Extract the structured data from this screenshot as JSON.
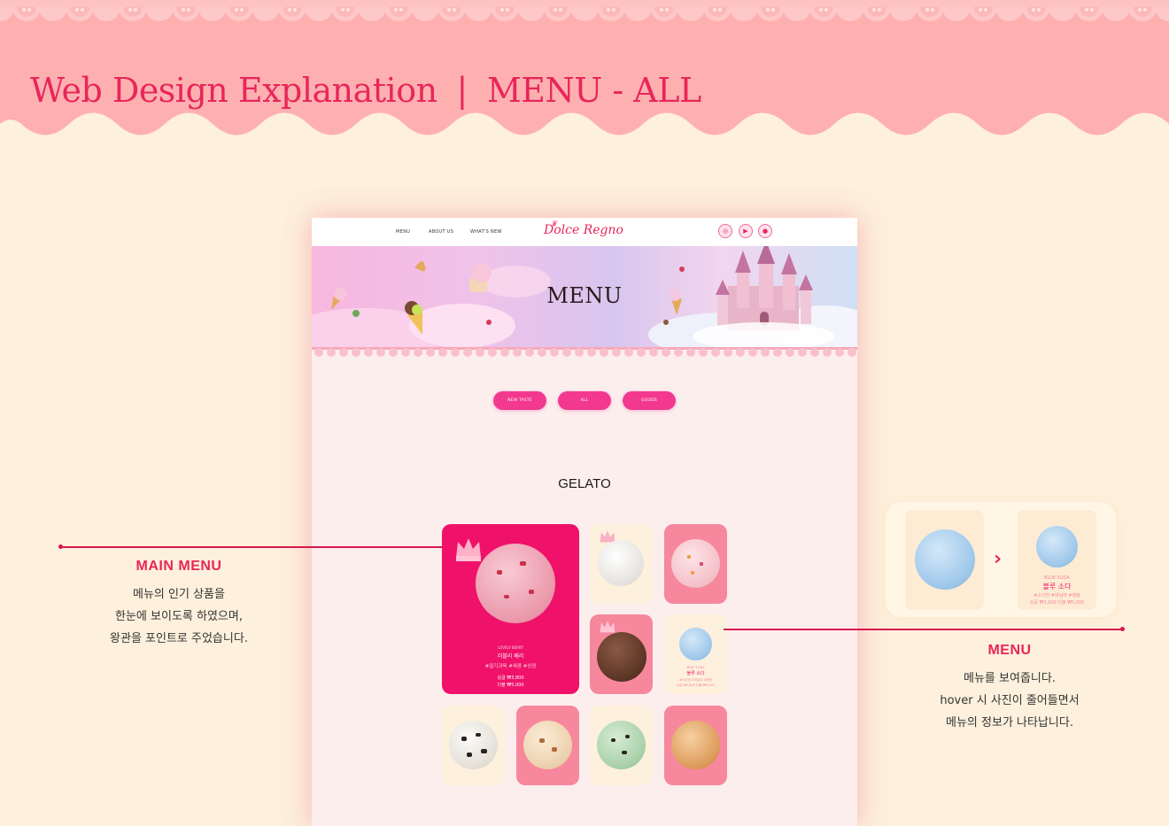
{
  "header": {
    "title_left": "Web Design Explanation",
    "separator": "|",
    "title_right": "MENU - ALL"
  },
  "colors": {
    "banner_pink": "#feb0b0",
    "accent": "#e8265a",
    "page_bg": "#fdf0dc",
    "tab_pink": "#f2398f",
    "feature_card": "#f0116a"
  },
  "site": {
    "nav": [
      "MENU",
      "ABOUT US",
      "WHAT'S NEW"
    ],
    "logo": "Dolce Regno",
    "sns_icons": [
      "instagram-icon",
      "youtube-icon",
      "kakao-icon"
    ],
    "hero_title": "MENU",
    "tabs": [
      "NEW TASTE",
      "ALL",
      "GOODS"
    ],
    "section_title": "GELATO",
    "featured": {
      "eng": "LOVELY BERRY",
      "name": "러블리 베리",
      "tags": "#딸기과육 #새콤 #상큼",
      "price_single": "싱글 ₩3,800",
      "price_double": "더블 ₩5,000"
    },
    "hover_item": {
      "eng": "BLUE SODA",
      "name": "블루 소다",
      "tags": "#소다맛 #바닐라 #청량",
      "price": "싱글 ₩3,800 더블 ₩5,000"
    }
  },
  "annotations": {
    "main_menu": {
      "title": "MAIN MENU",
      "line1": "메뉴의 인기 상품을",
      "line2": "한눈에 보이도록 하였으며,",
      "line3": "왕관을 포인트로 주었습니다."
    },
    "menu": {
      "title": "MENU",
      "line1": "메뉴를 보여줍니다.",
      "line2": "hover 시 사진이 줄어들면서",
      "line3": "메뉴의 정보가 나타납니다."
    },
    "hover_arrow": "›"
  }
}
